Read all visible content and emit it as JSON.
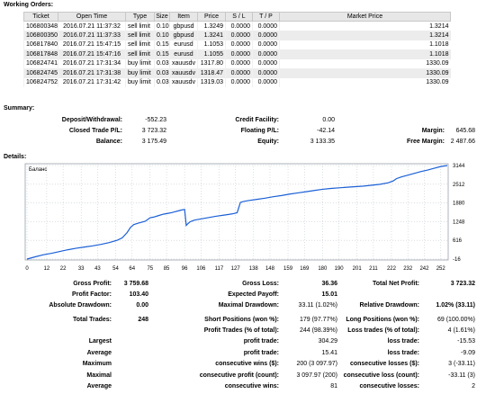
{
  "orders": {
    "title": "Working Orders:",
    "headers": [
      "Ticket",
      "Open Time",
      "Type",
      "Size",
      "Item",
      "Price",
      "S / L",
      "T / P",
      "Market Price"
    ],
    "rows": [
      [
        "106800348",
        "2016.07.21 11:37:32",
        "sell limit",
        "0.10",
        "gbpusd",
        "1.3249",
        "0.0000",
        "0.0000",
        "1.3214"
      ],
      [
        "106800350",
        "2016.07.21 11:37:33",
        "sell limit",
        "0.10",
        "gbpusd",
        "1.3241",
        "0.0000",
        "0.0000",
        "1.3214"
      ],
      [
        "106817840",
        "2016.07.21 15:47:15",
        "sell limit",
        "0.15",
        "eurusd",
        "1.1053",
        "0.0000",
        "0.0000",
        "1.1018"
      ],
      [
        "106817848",
        "2016.07.21 15:47:16",
        "sell limit",
        "0.15",
        "eurusd",
        "1.1055",
        "0.0000",
        "0.0000",
        "1.1018"
      ],
      [
        "106824741",
        "2016.07.21 17:31:34",
        "buy limit",
        "0.03",
        "xauusdv",
        "1317.80",
        "0.0000",
        "0.0000",
        "1330.09"
      ],
      [
        "106824745",
        "2016.07.21 17:31:38",
        "buy limit",
        "0.03",
        "xauusdv",
        "1318.47",
        "0.0000",
        "0.0000",
        "1330.09"
      ],
      [
        "106824752",
        "2016.07.21 17:31:42",
        "buy limit",
        "0.03",
        "xauusdv",
        "1319.03",
        "0.0000",
        "0.0000",
        "1330.09"
      ]
    ]
  },
  "summary": {
    "title": "Summary:",
    "deposit_label": "Deposit/Withdrawal:",
    "deposit": "-552.23",
    "credit_label": "Credit Facility:",
    "credit": "0.00",
    "closed_pl_label": "Closed Trade P/L:",
    "closed_pl": "3 723.32",
    "floating_pl_label": "Floating P/L:",
    "floating_pl": "-42.14",
    "margin_label": "Margin:",
    "margin": "645.68",
    "balance_label": "Balance:",
    "balance": "3 175.49",
    "equity_label": "Equity:",
    "equity": "3 133.35",
    "free_margin_label": "Free Margin:",
    "free_margin": "2 487.66"
  },
  "details": {
    "title": "Details:"
  },
  "chart_data": {
    "type": "line",
    "legend": "Баланс",
    "x_ticks": [
      0,
      12,
      22,
      33,
      43,
      54,
      64,
      75,
      85,
      96,
      106,
      117,
      127,
      138,
      148,
      159,
      169,
      180,
      190,
      201,
      211,
      222,
      232,
      242,
      252
    ],
    "y_ticks": [
      3144,
      2512,
      1880,
      1248,
      616,
      -16
    ],
    "ylim": [
      -16,
      3144
    ],
    "xlim": [
      0,
      256
    ],
    "grid": true,
    "line_color": "#1a5fd6",
    "series": [
      {
        "x": [
          0,
          5,
          10,
          15,
          20,
          25,
          30,
          35,
          40,
          45,
          50,
          55,
          58,
          61,
          63,
          65,
          68,
          72,
          75,
          77,
          80,
          83,
          86,
          88,
          90,
          92,
          94,
          96,
          97,
          98,
          99,
          100,
          102,
          105,
          110,
          115,
          120,
          125,
          128,
          130,
          132,
          135,
          140,
          145,
          150,
          155,
          160,
          165,
          170,
          175,
          180,
          185,
          190,
          195,
          200,
          205,
          210,
          215,
          220,
          223,
          225,
          228,
          232,
          236,
          240,
          244,
          248,
          252,
          256
        ],
        "y": [
          -16,
          60,
          130,
          180,
          240,
          300,
          350,
          390,
          430,
          480,
          540,
          620,
          700,
          880,
          1050,
          1150,
          1200,
          1260,
          1380,
          1400,
          1450,
          1500,
          1530,
          1550,
          1580,
          1610,
          1640,
          1660,
          1120,
          1180,
          1230,
          1260,
          1300,
          1330,
          1380,
          1430,
          1470,
          1510,
          1550,
          1900,
          1930,
          1960,
          2000,
          2040,
          2090,
          2130,
          2180,
          2220,
          2260,
          2300,
          2340,
          2370,
          2390,
          2410,
          2430,
          2450,
          2480,
          2510,
          2560,
          2620,
          2700,
          2760,
          2820,
          2880,
          2940,
          2990,
          3050,
          3110,
          3144
        ]
      }
    ]
  },
  "stats": [
    {
      "label": "Gross Profit:",
      "value": "3 759.68",
      "bold": true,
      "label2": "Gross Loss:",
      "value2": "36.36",
      "bold2": true,
      "label3": "Total Net Profit:",
      "value3": "3 723.32",
      "bold3": true
    },
    {
      "label": "Profit Factor:",
      "value": "103.40",
      "bold": true,
      "label2": "Expected Payoff:",
      "value2": "15.01",
      "bold2": true,
      "label3": "",
      "value3": "",
      "bold3": false
    },
    {
      "label": "Absolute Drawdown:",
      "value": "0.00",
      "bold": true,
      "label2": "Maximal Drawdown:",
      "value2": "33.11 (1.02%)",
      "bold2": false,
      "label3": "Relative Drawdown:",
      "value3": "1.02% (33.11)",
      "bold3": true
    },
    {
      "label": "Total Trades:",
      "value": "248",
      "bold": true,
      "label2": "Short Positions (won %):",
      "value2": "179 (97.77%)",
      "bold2": false,
      "label3": "Long Positions (won %):",
      "value3": "69 (100.00%)",
      "bold3": false
    },
    {
      "label": "",
      "value": "",
      "bold": false,
      "label2": "Profit Trades (% of total):",
      "value2": "244 (98.39%)",
      "bold2": false,
      "label3": "Loss trades (% of total):",
      "value3": "4 (1.61%)",
      "bold3": false
    },
    {
      "label": "Largest",
      "value": "",
      "bold": false,
      "label2": "profit trade:",
      "value2": "304.29",
      "bold2": false,
      "label3": "loss trade:",
      "value3": "-15.53",
      "bold3": false
    },
    {
      "label": "Average",
      "value": "",
      "bold": false,
      "label2": "profit trade:",
      "value2": "15.41",
      "bold2": false,
      "label3": "loss trade:",
      "value3": "-9.09",
      "bold3": false
    },
    {
      "label": "Maximum",
      "value": "",
      "bold": false,
      "label2": "consecutive wins ($):",
      "value2": "200 (3 097.97)",
      "bold2": false,
      "label3": "consecutive losses ($):",
      "value3": "3 (-33.11)",
      "bold3": false
    },
    {
      "label": "Maximal",
      "value": "",
      "bold": false,
      "label2": "consecutive profit (count):",
      "value2": "3 097.97 (200)",
      "bold2": false,
      "label3": "consecutive loss (count):",
      "value3": "-33.11 (3)",
      "bold3": false
    },
    {
      "label": "Average",
      "value": "",
      "bold": false,
      "label2": "consecutive wins:",
      "value2": "81",
      "bold2": false,
      "label3": "consecutive losses:",
      "value3": "2",
      "bold3": false
    }
  ]
}
